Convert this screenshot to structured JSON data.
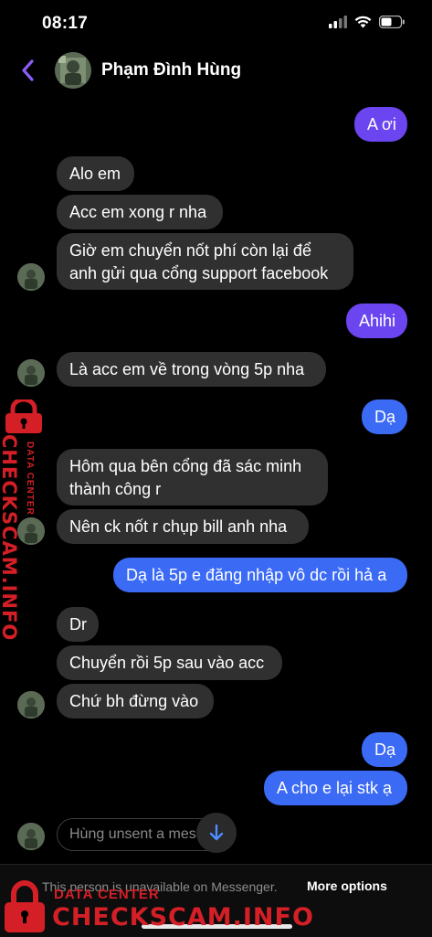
{
  "status_bar": {
    "time": "08:17"
  },
  "header": {
    "contact_name": "Phạm Đình Hùng"
  },
  "messages": [
    {
      "text": "A ơi"
    },
    {
      "text": "Alo em"
    },
    {
      "text": "Acc em xong r nha"
    },
    {
      "text": "Giờ em chuyển nốt phí còn lại để"
    },
    {
      "text": "anh gửi qua cổng support facebook"
    },
    {
      "text": "Ahihi"
    },
    {
      "text": "Là acc em về trong vòng 5p nha"
    },
    {
      "text": "Dạ"
    },
    {
      "text": "Hôm qua bên cổng đã sác minh"
    },
    {
      "text": "thành công r"
    },
    {
      "text": "Nên ck nốt r chụp bill anh nha"
    },
    {
      "text": "Dạ là 5p e đăng nhập vô dc rồi hả a"
    },
    {
      "text": "Dr"
    },
    {
      "text": "Chuyển rồi 5p sau vào acc"
    },
    {
      "text": "Chứ bh đừng vào"
    },
    {
      "text": "Dạ"
    },
    {
      "text": "A cho e lại stk ạ"
    }
  ],
  "unsent_notice": "Hùng unsent a mess",
  "footer": {
    "unavailable_text": "This person is unavailable on Messenger.",
    "more_options": "More options"
  },
  "watermark": {
    "small": "DATA CENTER",
    "big": "CHECKSCAM.INFO"
  },
  "colors": {
    "outgoing_purple": "#6b46f0",
    "outgoing_blue": "#3b6af5",
    "incoming": "#303030",
    "accent_back": "#8b5cf6",
    "watermark_red": "#d41f27"
  }
}
